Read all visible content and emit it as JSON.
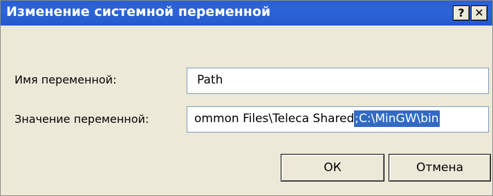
{
  "window": {
    "title": "Изменение системной переменной",
    "help_label": "?",
    "close_label": "✕",
    "help_icon": "help-question-icon",
    "close_icon": "close-x-icon"
  },
  "form": {
    "name_label": "Имя переменной:",
    "name_value": "Path",
    "value_label": "Значение переменной:",
    "value_text_unselected": "ommon Files\\Teleca Shared",
    "value_text_selected": ";C:\\MinGW\\bin"
  },
  "buttons": {
    "ok_label": "ОК",
    "cancel_label": "Отмена"
  },
  "colors": {
    "titlebar": "#2a5fd0",
    "selection": "#316ac5",
    "dialog_bg": "#ece9d8"
  }
}
